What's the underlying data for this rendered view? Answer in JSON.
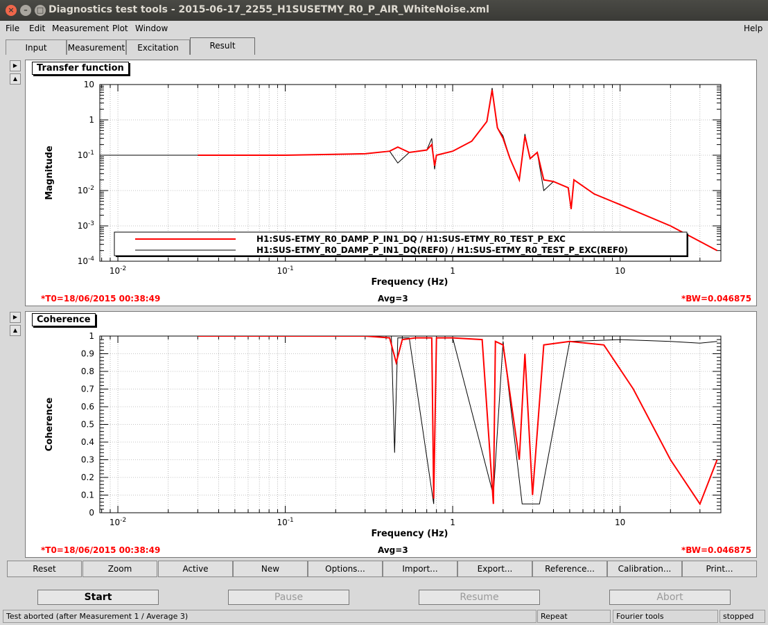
{
  "window": {
    "title": "Diagnostics test tools - 2015-06-17_2255_H1SUSETMY_R0_P_AIR_WhiteNoise.xml"
  },
  "menu": {
    "file": "File",
    "edit": "Edit",
    "measurement": "Measurement",
    "plot": "Plot",
    "window": "Window",
    "help": "Help"
  },
  "tabs": [
    "Input",
    "Measurement",
    "Excitation",
    "Result"
  ],
  "colors": {
    "red": "#ff0000",
    "black": "#000000"
  },
  "plots": {
    "tf": {
      "label": "Transfer function",
      "ylabel": "Magnitude",
      "xlabel": "Frequency (Hz)",
      "t0": "*T0=18/06/2015 00:38:49",
      "avg": "Avg=3",
      "bw": "*BW=0.046875",
      "legend": [
        "H1:SUS-ETMY_R0_DAMP_P_IN1_DQ / H1:SUS-ETMY_R0_TEST_P_EXC",
        "H1:SUS-ETMY_R0_DAMP_P_IN1_DQ(REF0) / H1:SUS-ETMY_R0_TEST_P_EXC(REF0)"
      ],
      "yticks": [
        "10",
        "1",
        "10^-1",
        "10^-2",
        "10^-3",
        "10^-4"
      ],
      "xticks": [
        "10^-2",
        "10^-1",
        "1",
        "10"
      ]
    },
    "coh": {
      "label": "Coherence",
      "ylabel": "Coherence",
      "xlabel": "Frequency (Hz)",
      "t0": "*T0=18/06/2015 00:38:49",
      "avg": "Avg=3",
      "bw": "*BW=0.046875",
      "yticks": [
        "1",
        "0.9",
        "0.8",
        "0.7",
        "0.6",
        "0.5",
        "0.4",
        "0.3",
        "0.2",
        "0.1",
        "0"
      ],
      "xticks": [
        "10^-2",
        "10^-1",
        "1",
        "10"
      ]
    }
  },
  "chart_data": [
    {
      "type": "line",
      "title": "Transfer function",
      "xlabel": "Frequency (Hz)",
      "ylabel": "Magnitude",
      "xscale": "log",
      "yscale": "log",
      "xlim": [
        0.0078,
        40
      ],
      "ylim": [
        0.0001,
        10
      ],
      "grid": true,
      "legend_position": "bottom",
      "series": [
        {
          "name": "H1:SUS-ETMY_R0_DAMP_P_IN1_DQ / H1:SUS-ETMY_R0_TEST_P_EXC",
          "color": "#ff0000",
          "x": [
            0.03,
            0.1,
            0.3,
            0.42,
            0.47,
            0.55,
            0.7,
            0.75,
            0.78,
            0.8,
            1.0,
            1.3,
            1.6,
            1.72,
            1.85,
            2.0,
            2.2,
            2.5,
            2.7,
            2.9,
            3.2,
            3.5,
            4.0,
            4.9,
            5.1,
            5.3,
            7,
            10,
            20,
            38
          ],
          "y": [
            0.1,
            0.1,
            0.11,
            0.13,
            0.17,
            0.12,
            0.14,
            0.2,
            0.05,
            0.1,
            0.13,
            0.25,
            0.9,
            7.0,
            0.6,
            0.3,
            0.08,
            0.02,
            0.35,
            0.08,
            0.12,
            0.02,
            0.018,
            0.012,
            0.003,
            0.02,
            0.008,
            0.004,
            0.001,
            0.0002
          ]
        },
        {
          "name": "H1:SUS-ETMY_R0_DAMP_P_IN1_DQ(REF0) / H1:SUS-ETMY_R0_TEST_P_EXC(REF0)",
          "color": "#000000",
          "x": [
            0.008,
            0.03,
            0.1,
            0.3,
            0.42,
            0.47,
            0.55,
            0.7,
            0.75,
            0.78,
            0.8,
            1.0,
            1.3,
            1.6,
            1.72,
            1.85,
            2.0,
            2.2,
            2.5,
            2.7,
            2.9,
            3.2,
            3.5,
            4.0,
            4.9,
            5.1,
            5.3
          ],
          "y": [
            0.1,
            0.1,
            0.1,
            0.11,
            0.13,
            0.06,
            0.12,
            0.14,
            0.3,
            0.04,
            0.1,
            0.13,
            0.25,
            0.9,
            8.0,
            0.6,
            0.35,
            0.08,
            0.02,
            0.4,
            0.08,
            0.12,
            0.01,
            0.018,
            0.012,
            0.003,
            0.02
          ]
        }
      ]
    },
    {
      "type": "line",
      "title": "Coherence",
      "xlabel": "Frequency (Hz)",
      "ylabel": "Coherence",
      "xscale": "log",
      "xlim": [
        0.0078,
        40
      ],
      "ylim": [
        0,
        1
      ],
      "grid": true,
      "series": [
        {
          "name": "H1:SUS-ETMY_R0_DAMP_P_IN1_DQ / H1:SUS-ETMY_R0_TEST_P_EXC",
          "color": "#ff0000",
          "x": [
            0.03,
            0.3,
            0.42,
            0.46,
            0.5,
            0.6,
            0.75,
            0.77,
            0.8,
            1.0,
            1.5,
            1.75,
            1.8,
            2.0,
            2.5,
            2.7,
            3.0,
            3.5,
            5.0,
            8.0,
            12,
            20,
            30,
            38
          ],
          "y": [
            1.0,
            1.0,
            0.99,
            0.85,
            0.98,
            0.99,
            0.99,
            0.08,
            0.99,
            0.99,
            0.98,
            0.05,
            0.97,
            0.95,
            0.3,
            0.9,
            0.1,
            0.95,
            0.97,
            0.95,
            0.7,
            0.3,
            0.05,
            0.3
          ]
        },
        {
          "name": "H1:SUS-ETMY_R0_DAMP_P_IN1_DQ(REF0) / H1:SUS-ETMY_R0_TEST_P_EXC(REF0)",
          "color": "#000000",
          "x": [
            0.03,
            0.3,
            0.43,
            0.45,
            0.47,
            0.55,
            0.77,
            0.8,
            1.0,
            1.75,
            2.0,
            2.6,
            3.3,
            5.0,
            10,
            20,
            30,
            38
          ],
          "y": [
            1.0,
            1.0,
            1.0,
            0.34,
            0.99,
            0.99,
            0.05,
            0.99,
            0.99,
            0.1,
            0.97,
            0.05,
            0.05,
            0.97,
            0.98,
            0.97,
            0.96,
            0.97
          ]
        }
      ]
    }
  ],
  "toolbar": [
    "Reset",
    "Zoom",
    "Active",
    "New",
    "Options...",
    "Import...",
    "Export...",
    "Reference...",
    "Calibration...",
    "Print..."
  ],
  "controls": {
    "start": "Start",
    "pause": "Pause",
    "resume": "Resume",
    "abort": "Abort"
  },
  "status": {
    "message": "Test aborted (after Measurement 1 / Average 3)",
    "repeat": "Repeat",
    "tools": "Fourier tools",
    "state": "stopped"
  }
}
